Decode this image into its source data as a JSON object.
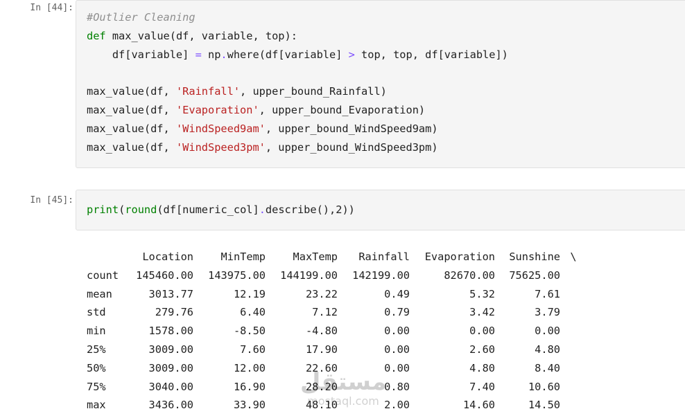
{
  "cells": [
    {
      "prompt": "In [44]:",
      "lines": [
        [
          {
            "t": "#Outlier Cleaning",
            "k": "comment"
          }
        ],
        [
          {
            "t": "def",
            "k": "keyword"
          },
          {
            "t": " max_value(df, variable, top):",
            "k": "plain"
          }
        ],
        [
          {
            "t": "    df[variable] ",
            "k": "plain"
          },
          {
            "t": "=",
            "k": "op"
          },
          {
            "t": " np",
            "k": "plain"
          },
          {
            "t": ".",
            "k": "op"
          },
          {
            "t": "where(df[variable] ",
            "k": "plain"
          },
          {
            "t": ">",
            "k": "op"
          },
          {
            "t": " top, top, df[variable])",
            "k": "plain"
          }
        ],
        [
          {
            "t": "",
            "k": "plain"
          }
        ],
        [
          {
            "t": "max_value(df, ",
            "k": "plain"
          },
          {
            "t": "'Rainfall'",
            "k": "string"
          },
          {
            "t": ", upper_bound_Rainfall)",
            "k": "plain"
          }
        ],
        [
          {
            "t": "max_value(df, ",
            "k": "plain"
          },
          {
            "t": "'Evaporation'",
            "k": "string"
          },
          {
            "t": ", upper_bound_Evaporation)",
            "k": "plain"
          }
        ],
        [
          {
            "t": "max_value(df, ",
            "k": "plain"
          },
          {
            "t": "'WindSpeed9am'",
            "k": "string"
          },
          {
            "t": ", upper_bound_WindSpeed9am)",
            "k": "plain"
          }
        ],
        [
          {
            "t": "max_value(df, ",
            "k": "plain"
          },
          {
            "t": "'WindSpeed3pm'",
            "k": "string"
          },
          {
            "t": ", upper_bound_WindSpeed3pm)",
            "k": "plain"
          }
        ]
      ]
    },
    {
      "prompt": "In [45]:",
      "lines": [
        [
          {
            "t": "print",
            "k": "builtin"
          },
          {
            "t": "(",
            "k": "plain"
          },
          {
            "t": "round",
            "k": "builtin"
          },
          {
            "t": "(df[numeric_col]",
            "k": "plain"
          },
          {
            "t": ".",
            "k": "op"
          },
          {
            "t": "describe(),",
            "k": "plain"
          },
          {
            "t": "2",
            "k": "number"
          },
          {
            "t": "))",
            "k": "plain"
          }
        ]
      ]
    }
  ],
  "output": {
    "columns": [
      "Location",
      "MinTemp",
      "MaxTemp",
      "Rainfall",
      "Evaporation",
      "Sunshine",
      "\\"
    ],
    "rows": [
      {
        "label": "count",
        "values": [
          "145460.00",
          "143975.00",
          "144199.00",
          "142199.00",
          "82670.00",
          "75625.00"
        ]
      },
      {
        "label": "mean",
        "values": [
          "3013.77",
          "12.19",
          "23.22",
          "0.49",
          "5.32",
          "7.61"
        ]
      },
      {
        "label": "std",
        "values": [
          "279.76",
          "6.40",
          "7.12",
          "0.79",
          "3.42",
          "3.79"
        ]
      },
      {
        "label": "min",
        "values": [
          "1578.00",
          "-8.50",
          "-4.80",
          "0.00",
          "0.00",
          "0.00"
        ]
      },
      {
        "label": "25%",
        "values": [
          "3009.00",
          "7.60",
          "17.90",
          "0.00",
          "2.60",
          "4.80"
        ]
      },
      {
        "label": "50%",
        "values": [
          "3009.00",
          "12.00",
          "22.60",
          "0.00",
          "4.80",
          "8.40"
        ]
      },
      {
        "label": "75%",
        "values": [
          "3040.00",
          "16.90",
          "28.20",
          "0.80",
          "7.40",
          "10.60"
        ]
      },
      {
        "label": "max",
        "values": [
          "3436.00",
          "33.90",
          "48.10",
          "2.00",
          "14.60",
          "14.50"
        ]
      }
    ]
  },
  "watermark": {
    "text": "mostaql.com",
    "logo_text": "مستقل"
  },
  "colors": {
    "cell_background": "#f5f5f5",
    "cell_border": "#e0e0e0",
    "prompt_text": "#616161",
    "comment": "#8e8e8e",
    "keyword": "#008000",
    "string": "#ba2121",
    "operator": "#7c4dff"
  }
}
